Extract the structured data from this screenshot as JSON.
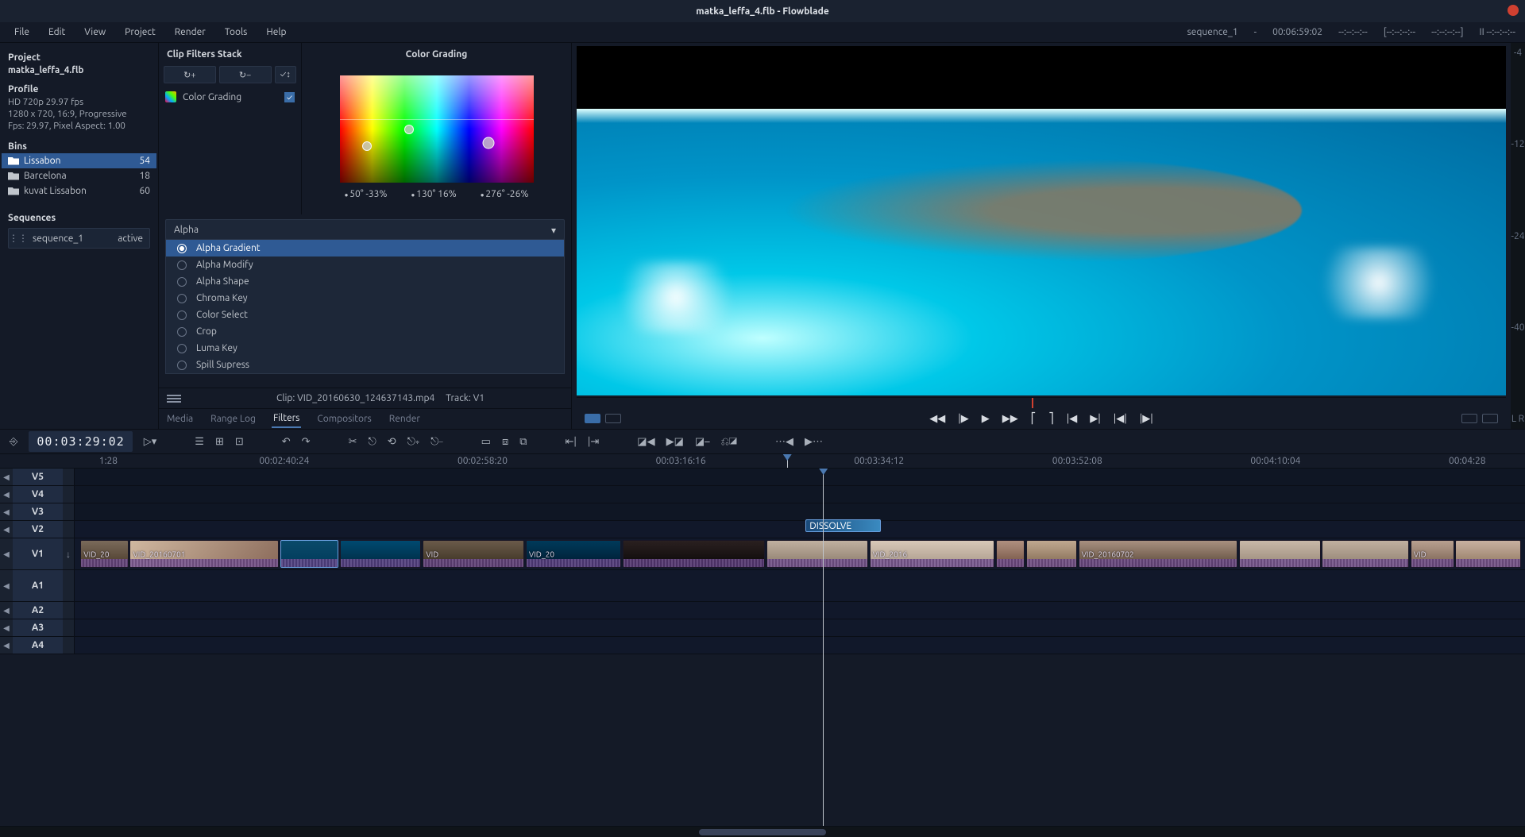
{
  "titlebar": {
    "title": "matka_leffa_4.flb - Flowblade"
  },
  "menu": [
    "File",
    "Edit",
    "View",
    "Project",
    "Render",
    "Tools",
    "Help"
  ],
  "statusbar": {
    "sequence": "sequence_1",
    "duration": "00:06:59:02",
    "tc1": "--:--:--:--",
    "tc2": "[--:--:--:--",
    "tc3": "--:--:--:--]",
    "tc4": "II --:--:--:--"
  },
  "project": {
    "heading": "Project",
    "name": "matka_leffa_4.flb",
    "profile_h": "Profile",
    "profile": [
      "HD 720p 29.97 fps",
      "1280 x 720, 16:9, Progressive",
      "Fps: 29.97, Pixel Aspect: 1.00"
    ],
    "bins_h": "Bins",
    "bins": [
      {
        "name": "Lissabon",
        "count": 54,
        "sel": true
      },
      {
        "name": "Barcelona",
        "count": 18,
        "sel": false
      },
      {
        "name": "kuvat Lissabon",
        "count": 60,
        "sel": false
      }
    ],
    "seq_h": "Sequences",
    "seq": {
      "name": "sequence_1",
      "state": "active"
    }
  },
  "filters": {
    "stack_h": "Clip Filters Stack",
    "btn_add": "↻+",
    "btn_del": "↻−",
    "btn_chk": "✓↕",
    "item": "Color Grading",
    "panel_h": "Color Grading",
    "values": [
      "50° -33%",
      "130° 16%",
      "276° -26%"
    ],
    "dd_label": "Alpha",
    "options": [
      "Alpha Gradient",
      "Alpha Modify",
      "Alpha Shape",
      "Chroma Key",
      "Color Select",
      "Crop",
      "Luma Key",
      "Spill Supress"
    ],
    "selected_option": "Alpha Gradient",
    "footer_clip": "Clip: VID_20160630_124637143.mp4",
    "footer_track": "Track: V1"
  },
  "tabs": [
    "Media",
    "Range Log",
    "Filters",
    "Compositors",
    "Render"
  ],
  "active_tab": "Filters",
  "vu_marks": [
    "-4",
    "-12",
    "-24",
    "-40",
    "L R"
  ],
  "timecode": "00:03:29:02",
  "ruler": [
    {
      "t": "1:28",
      "p": 6.5
    },
    {
      "t": "00:02:40:24",
      "p": 17
    },
    {
      "t": "00:02:58:20",
      "p": 30
    },
    {
      "t": "00:03:16:16",
      "p": 43
    },
    {
      "t": "00:03:34:12",
      "p": 56
    },
    {
      "t": "00:03:52:08",
      "p": 69
    },
    {
      "t": "00:04:10:04",
      "p": 82
    },
    {
      "t": "00:04:28",
      "p": 95
    }
  ],
  "playhead_pct": 51.6,
  "tracks_v": [
    "V5",
    "V4",
    "V3",
    "V2"
  ],
  "tracks_a": [
    "A1",
    "A2",
    "A3",
    "A4"
  ],
  "v1_label": "V1",
  "dissolve": "DISSOLVE",
  "clips": [
    {
      "l": 0.4,
      "w": 3.3,
      "lbl": "VID_20",
      "th": "linear-gradient(#7a6a5a,#4a3a2a)"
    },
    {
      "l": 3.8,
      "w": 10.3,
      "lbl": "VID_20160701",
      "th": "linear-gradient(135deg,#d0b8a0,#8a6a5a)"
    },
    {
      "l": 14.2,
      "w": 4.0,
      "lbl": "",
      "th": "linear-gradient(#0a4a6a,#003a5a)",
      "sel": true
    },
    {
      "l": 18.3,
      "w": 5.6,
      "lbl": "",
      "th": "linear-gradient(#004a70,#002840)"
    },
    {
      "l": 24.0,
      "w": 7.0,
      "lbl": "VID",
      "th": "linear-gradient(#6a5a4a,#3a3020)"
    },
    {
      "l": 31.1,
      "w": 6.6,
      "lbl": "VID_20",
      "th": "linear-gradient(#003a5a,#001a30)"
    },
    {
      "l": 37.8,
      "w": 9.8,
      "lbl": "",
      "th": "linear-gradient(#2a2020,#0a0808)"
    },
    {
      "l": 47.7,
      "w": 7.0,
      "lbl": "",
      "th": "linear-gradient(#c0b0a0,#8a7a6a)"
    },
    {
      "l": 54.8,
      "w": 8.6,
      "lbl": "VID_2016",
      "th": "linear-gradient(#d8c8b8,#a89888)"
    },
    {
      "l": 63.5,
      "w": 2.0,
      "lbl": "",
      "th": "linear-gradient(#b09080,#705040)"
    },
    {
      "l": 65.6,
      "w": 3.5,
      "lbl": "",
      "th": "linear-gradient(#c0a890,#806850)"
    },
    {
      "l": 69.2,
      "w": 11.0,
      "lbl": "VID_20160702",
      "th": "linear-gradient(#a89080,#5a4838)"
    },
    {
      "l": 80.3,
      "w": 5.6,
      "lbl": "",
      "th": "linear-gradient(#c8b8a8,#988878)"
    },
    {
      "l": 86.0,
      "w": 6.0,
      "lbl": "",
      "th": "linear-gradient(#c0b0a0,#908070)"
    },
    {
      "l": 92.1,
      "w": 3.0,
      "lbl": "VID",
      "th": "linear-gradient(#b8a090,#786050)"
    },
    {
      "l": 95.2,
      "w": 4.5,
      "lbl": "",
      "th": "linear-gradient(#c8b0a0,#907860)"
    }
  ]
}
